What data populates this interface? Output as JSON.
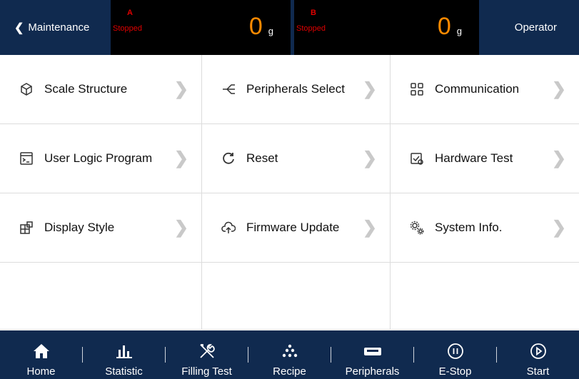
{
  "header": {
    "back_label": "Maintenance",
    "scale_a": {
      "channel": "A",
      "status": "Stopped",
      "weight": "0",
      "unit": "g"
    },
    "scale_b": {
      "channel": "B",
      "status": "Stopped",
      "weight": "0",
      "unit": "g"
    },
    "user": "Operator"
  },
  "menu": {
    "scale_structure": "Scale Structure",
    "peripherals_select": "Peripherals Select",
    "communication": "Communication",
    "user_logic_program": "User Logic Program",
    "reset": "Reset",
    "hardware_test": "Hardware Test",
    "display_style": "Display Style",
    "firmware_update": "Firmware Update",
    "system_info": "System Info."
  },
  "nav": {
    "home": "Home",
    "statistic": "Statistic",
    "filling_test": "Filling Test",
    "recipe": "Recipe",
    "peripherals": "Peripherals",
    "estop": "E-Stop",
    "start": "Start"
  },
  "colors": {
    "header_bg": "#102a4f",
    "status_red": "#e00000",
    "weight_orange": "#ff8a00"
  }
}
